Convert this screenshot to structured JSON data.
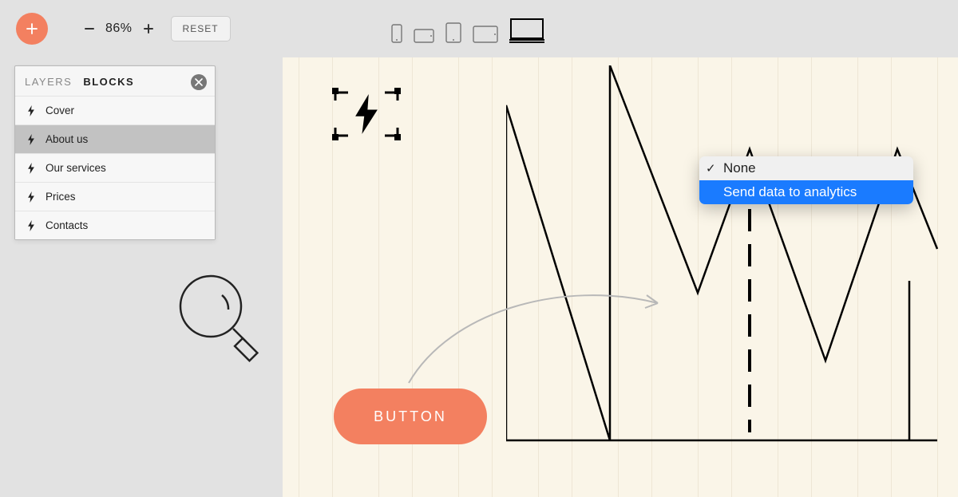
{
  "toolbar": {
    "zoom_value": "86%",
    "reset_label": "RESET"
  },
  "devices": [
    "phone",
    "tablet-landscape-small",
    "tablet-portrait",
    "tablet-landscape",
    "desktop"
  ],
  "panel": {
    "tabs": {
      "layers": "LAYERS",
      "blocks": "BLOCKS"
    },
    "items": [
      {
        "label": "Cover"
      },
      {
        "label": "About us"
      },
      {
        "label": "Our services"
      },
      {
        "label": "Prices"
      },
      {
        "label": "Contacts"
      }
    ],
    "active_item_index": 1
  },
  "canvas": {
    "button_label": "BUTTON"
  },
  "dropdown": {
    "items": [
      {
        "label": "None",
        "checked": true
      },
      {
        "label": "Send data to analytics",
        "highlighted": true
      }
    ]
  },
  "chart_data": {
    "type": "line",
    "x": [
      0,
      1,
      2,
      3,
      4,
      5,
      6
    ],
    "values": [
      470,
      470,
      0,
      285,
      105,
      370,
      105
    ],
    "note": "y values are approximate pixel-height positions read off the decorative polyline; no axes or labels present",
    "title": "",
    "xlabel": "",
    "ylabel": ""
  },
  "colors": {
    "accent": "#f38060",
    "canvas_bg": "#faf5e8",
    "highlight_blue": "#1a7bff"
  }
}
